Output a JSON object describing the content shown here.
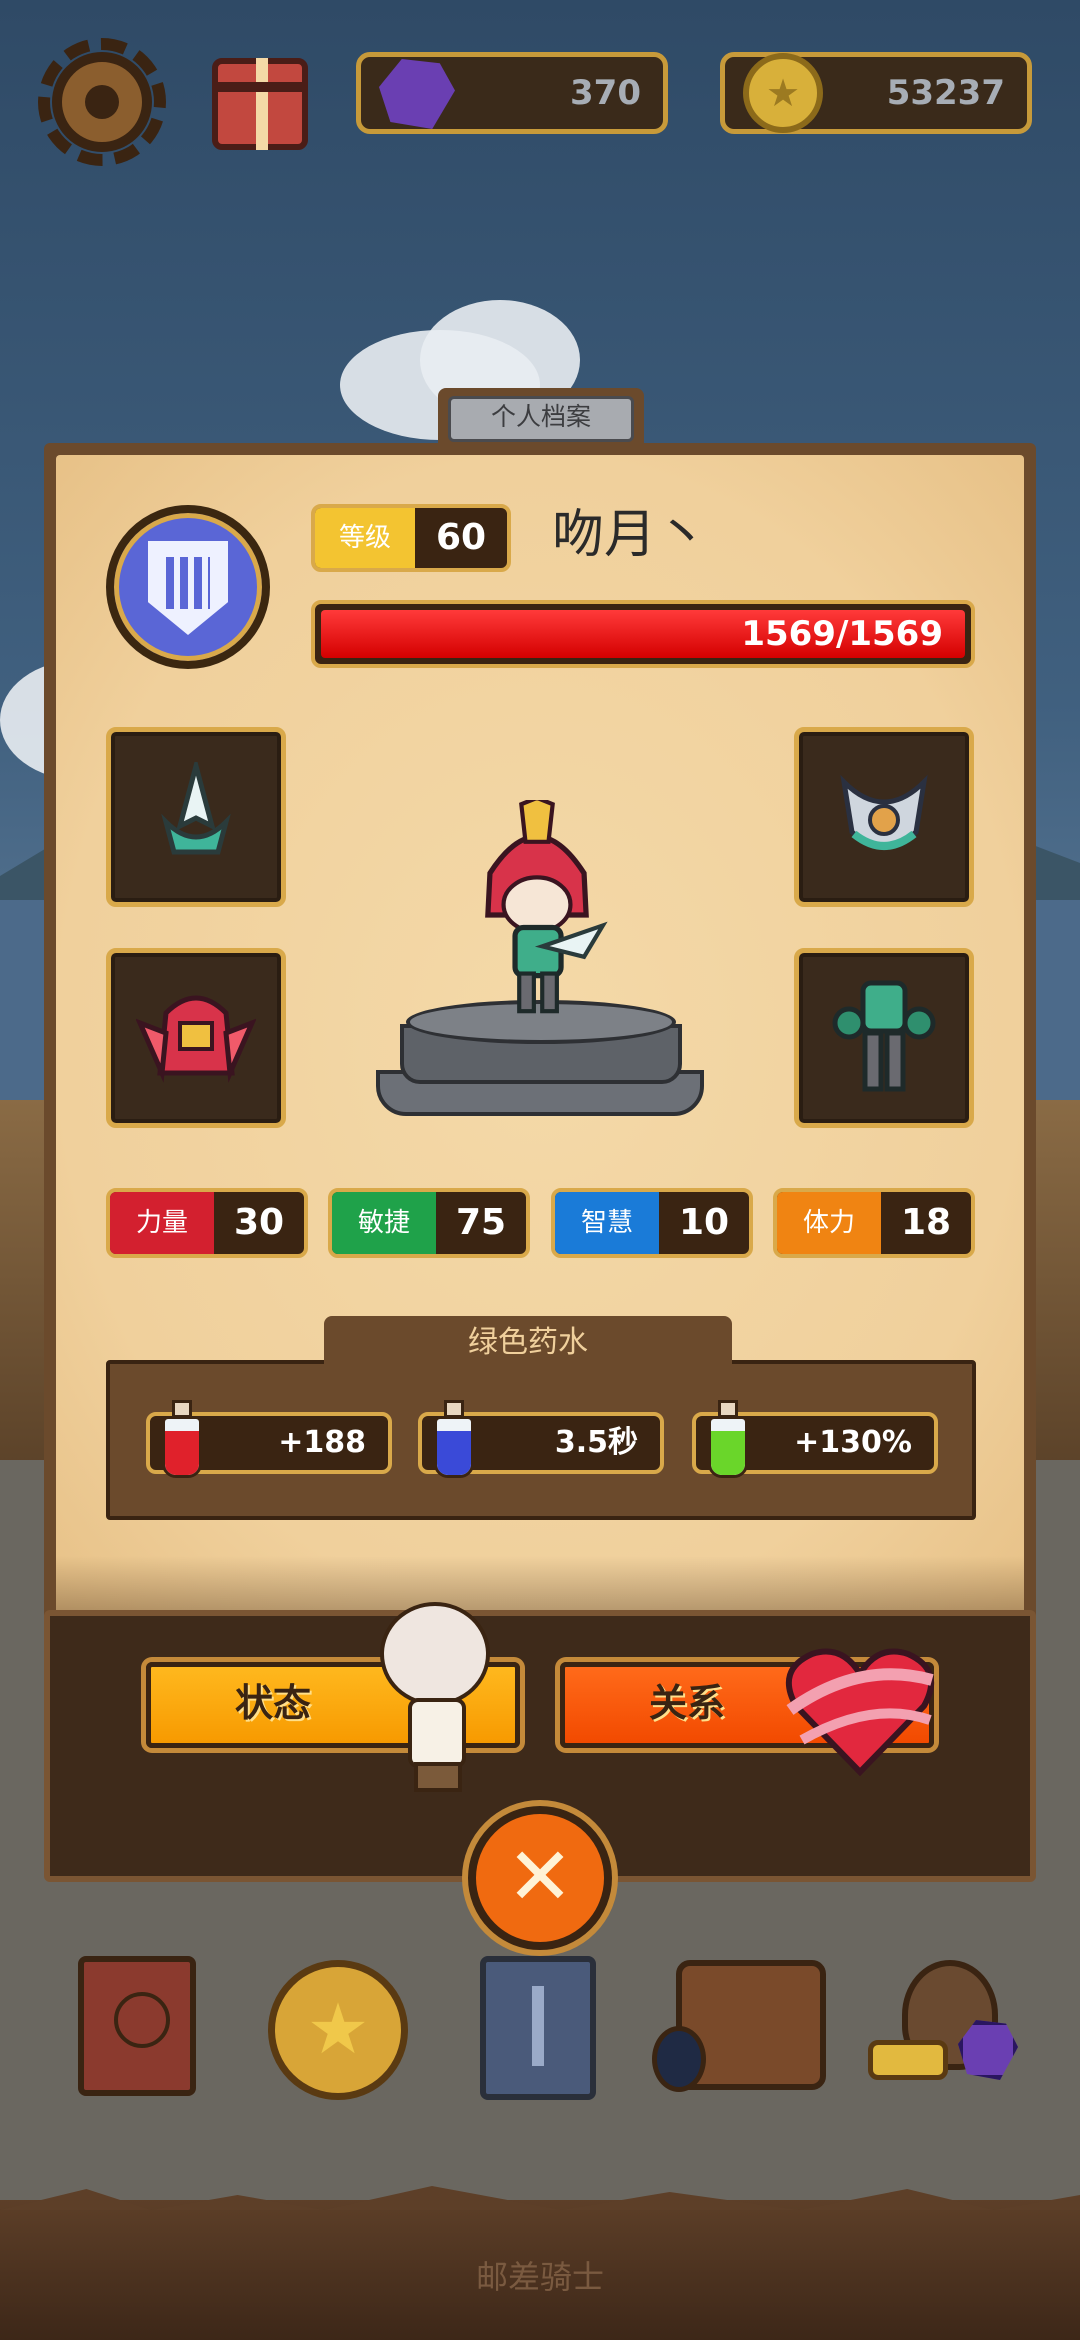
{
  "topbar": {
    "settings_icon": "gear-icon",
    "gift_icon": "gift-box-icon",
    "gems": "370",
    "coins": "53237",
    "gem_icon": "purple-gem-icon",
    "coin_icon": "gold-coin-icon"
  },
  "profile": {
    "tab_label": "个人档案",
    "emblem_icon": "shield-emblem-icon",
    "level_label": "等级",
    "level": "60",
    "name": "吻月丶",
    "hp_text": "1569/1569",
    "hp_fraction": 1.0
  },
  "equipment": {
    "weapon_icon": "spear-tip-icon",
    "helmet_icon": "winged-helmet-icon",
    "accessory_icon": "winged-amulet-icon",
    "armor_icon": "armor-suit-icon"
  },
  "stats": [
    {
      "label": "力量",
      "value": "30",
      "color": "#d3202f"
    },
    {
      "label": "敏捷",
      "value": "75",
      "color": "#1fa24a"
    },
    {
      "label": "智慧",
      "value": "10",
      "color": "#1a7bd8"
    },
    {
      "label": "体力",
      "value": "18",
      "color": "#f08412"
    }
  ],
  "potion": {
    "title": "绿色药水",
    "items": [
      {
        "value": "+188",
        "liquid": "#e0212b",
        "icon": "red-potion-heart-icon"
      },
      {
        "value": "3.5秒",
        "liquid": "#3a4ad8",
        "icon": "blue-potion-hourglass-icon"
      },
      {
        "value": "+130%",
        "liquid": "#6ad62a",
        "icon": "green-potion-boost-icon"
      }
    ]
  },
  "actions": {
    "status_label": "状态",
    "relation_label": "关系",
    "close_icon": "close-icon"
  },
  "nav": {
    "items": [
      "book-icon",
      "star-coin-icon",
      "card-deck-icon",
      "backpack-icon",
      "loot-bag-icon"
    ]
  },
  "footer": {
    "title": "邮差骑士"
  }
}
